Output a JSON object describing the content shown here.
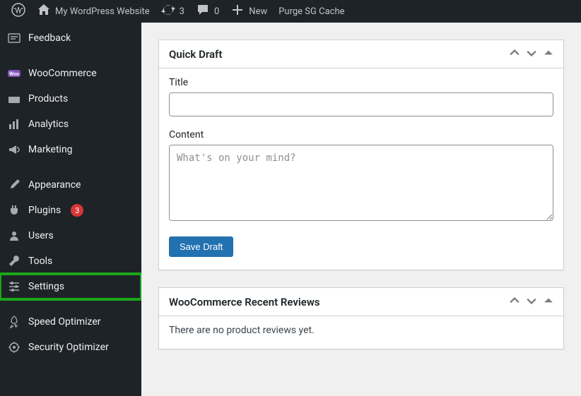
{
  "adminbar": {
    "site_title": "My WordPress Website",
    "updates_count": "3",
    "comments_count": "0",
    "new_label": "New",
    "purge_label": "Purge SG Cache"
  },
  "sidebar": {
    "items": [
      {
        "label": "Feedback"
      },
      {
        "label": "WooCommerce"
      },
      {
        "label": "Products"
      },
      {
        "label": "Analytics"
      },
      {
        "label": "Marketing"
      },
      {
        "label": "Appearance"
      },
      {
        "label": "Plugins",
        "badge": "3"
      },
      {
        "label": "Users"
      },
      {
        "label": "Tools"
      },
      {
        "label": "Settings"
      },
      {
        "label": "Speed Optimizer"
      },
      {
        "label": "Security Optimizer"
      }
    ]
  },
  "quick_draft": {
    "heading": "Quick Draft",
    "title_label": "Title",
    "title_value": "",
    "content_label": "Content",
    "content_placeholder": "What's on your mind?",
    "content_value": "",
    "save_label": "Save Draft"
  },
  "reviews": {
    "heading": "WooCommerce Recent Reviews",
    "empty_text": "There are no product reviews yet."
  }
}
